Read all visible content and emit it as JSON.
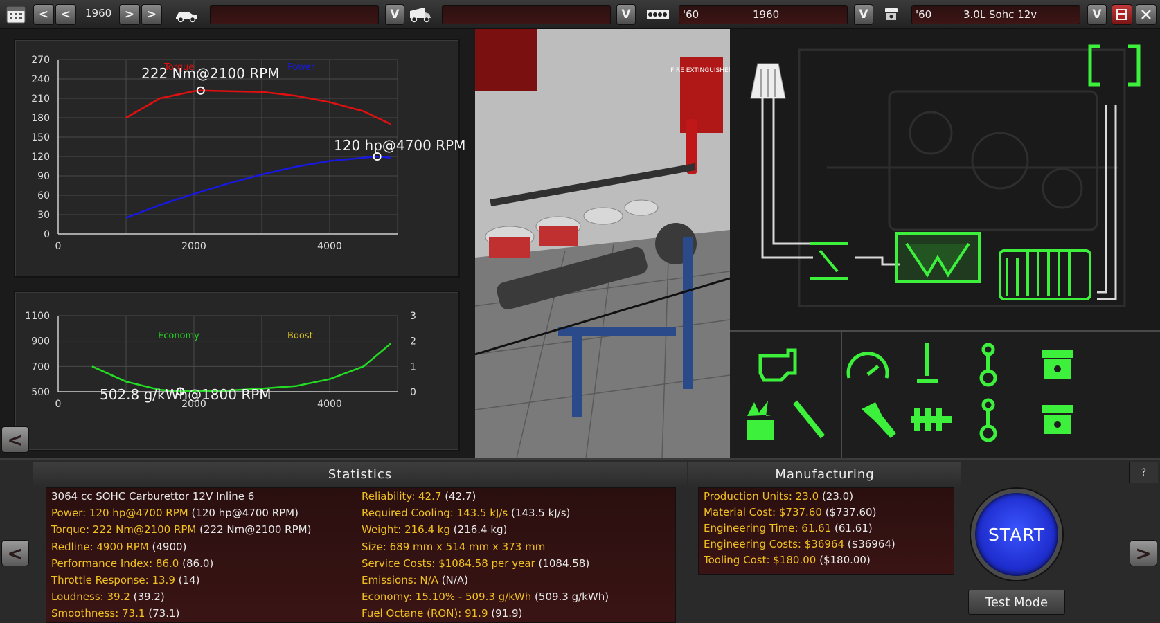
{
  "topbar": {
    "year_display": "1960",
    "prev_label": "<",
    "next_label": ">",
    "dropdown_label": "V",
    "family_year_short": "'60",
    "family_year": "1960",
    "variant_year_short": "'60",
    "variant_name": "3.0L Sohc 12v",
    "icons": [
      "calendar-icon",
      "car-icon",
      "van-icon",
      "engine-block-icon",
      "piston-head-icon",
      "save-icon",
      "close-icon"
    ]
  },
  "power_chart": {
    "legend_torque": "Torque",
    "legend_power": "Power",
    "torque_annotation": "222 Nm@2100 RPM",
    "power_annotation": "120 hp@4700 RPM",
    "y_ticks": [
      "270",
      "240",
      "210",
      "180",
      "150",
      "120",
      "90",
      "60",
      "30",
      "0"
    ],
    "x_ticks": [
      "0",
      "2000",
      "4000"
    ],
    "colors": {
      "torque": "#e01010",
      "power": "#1818e0"
    }
  },
  "economy_chart": {
    "legend_economy": "Economy",
    "legend_boost": "Boost",
    "economy_annotation": "502.8 g/kWh@1800 RPM",
    "y_ticks": [
      "1100",
      "900",
      "700",
      "500"
    ],
    "y2_ticks": [
      "3",
      "2",
      "1",
      "0"
    ],
    "x_ticks": [
      "0",
      "2000",
      "4000"
    ],
    "colors": {
      "economy": "#22dd22",
      "boost": "#d4c020"
    }
  },
  "chart_data": [
    {
      "type": "line",
      "x_label": "",
      "y_label": "",
      "xlim": [
        0,
        5000
      ],
      "ylim": [
        0,
        270
      ],
      "series": [
        {
          "name": "Torque",
          "x": [
            1000,
            1500,
            2000,
            2100,
            2500,
            3000,
            3500,
            4000,
            4500,
            4900
          ],
          "y": [
            180,
            210,
            221,
            222,
            221,
            220,
            214,
            204,
            190,
            170
          ]
        },
        {
          "name": "Power",
          "x": [
            1000,
            1500,
            2000,
            2500,
            3000,
            3500,
            4000,
            4500,
            4700,
            4900
          ],
          "y": [
            25,
            45,
            62,
            78,
            92,
            104,
            113,
            118,
            120,
            118
          ]
        }
      ],
      "annotations": [
        "222 Nm@2100 RPM",
        "120 hp@4700 RPM"
      ]
    },
    {
      "type": "line",
      "xlim": [
        0,
        5000
      ],
      "ylim": [
        500,
        1100
      ],
      "y2lim": [
        0,
        3
      ],
      "series": [
        {
          "name": "Economy",
          "x": [
            500,
            1000,
            1500,
            1800,
            2500,
            3000,
            3500,
            4000,
            4500,
            4900
          ],
          "y": [
            700,
            580,
            515,
            503,
            510,
            525,
            545,
            600,
            700,
            880
          ]
        }
      ],
      "annotations": [
        "502.8 g/kWh@1800 RPM"
      ]
    }
  ],
  "statistics": {
    "header": "Statistics",
    "left": [
      {
        "k": "3064 cc SOHC Carburettor 12V Inline 6",
        "v": ""
      },
      {
        "k": "Power: 120 hp@4700 RPM",
        "v": "(120 hp@4700 RPM)"
      },
      {
        "k": "Torque: 222 Nm@2100 RPM",
        "v": "(222 Nm@2100 RPM)"
      },
      {
        "k": "Redline: 4900 RPM",
        "v": "(4900)"
      },
      {
        "k": "Performance Index: 86.0",
        "v": "(86.0)"
      },
      {
        "k": "Throttle Response: 13.9",
        "v": "(14)"
      },
      {
        "k": "Loudness: 39.2",
        "v": "(39.2)"
      },
      {
        "k": "Smoothness: 73.1",
        "v": "(73.1)"
      }
    ],
    "right": [
      {
        "k": "Reliability: 42.7",
        "v": "(42.7)"
      },
      {
        "k": "Required Cooling: 143.5 kJ/s",
        "v": "(143.5 kJ/s)"
      },
      {
        "k": "Weight: 216.4 kg",
        "v": "(216.4 kg)"
      },
      {
        "k": "Size: 689 mm x 514 mm x 373 mm",
        "v": ""
      },
      {
        "k": "Service Costs: $1084.58 per year",
        "v": "(1084.58)"
      },
      {
        "k": "Emissions: N/A",
        "v": "(N/A)"
      },
      {
        "k": "Economy: 15.10% - 509.3 g/kWh",
        "v": "(509.3 g/kWh)"
      },
      {
        "k": "Fuel Octane (RON): 91.9",
        "v": "(91.9)"
      }
    ]
  },
  "manufacturing": {
    "header": "Manufacturing",
    "lines": [
      {
        "k": "Production Units: 23.0",
        "v": "(23.0)"
      },
      {
        "k": "Material Cost: $737.60",
        "v": "($737.60)"
      },
      {
        "k": "Engineering Time: 61.61",
        "v": "(61.61)"
      },
      {
        "k": "Engineering Costs: $36964",
        "v": "($36964)"
      },
      {
        "k": "Tooling Cost: $180.00",
        "v": "($180.00)"
      }
    ]
  },
  "actions": {
    "start_label": "START",
    "test_mode_label": "Test Mode",
    "help_label": "?",
    "arrow_left": "<",
    "arrow_right": ">"
  },
  "scene": {
    "sign_title": "FIRE EXTINGUISHER"
  }
}
